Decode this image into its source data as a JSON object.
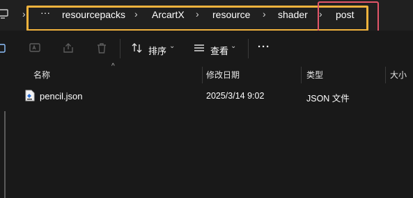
{
  "address_bar": {
    "overflow_label": "···",
    "crumbs": [
      "resourcepacks",
      "ArcartX",
      "resource",
      "shader",
      "post"
    ]
  },
  "toolbar": {
    "sort_label": "排序",
    "view_label": "查看",
    "more_label": "···"
  },
  "columns": {
    "name": "名称",
    "modified": "修改日期",
    "type": "类型",
    "size": "大小"
  },
  "files": [
    {
      "name": "pencil.json",
      "modified": "2025/3/14 9:02",
      "type": "JSON 文件",
      "icon": "json-file-icon"
    }
  ],
  "colors": {
    "highlight_yellow": "#f2b33d",
    "highlight_red": "#e5566a",
    "background": "#191919"
  }
}
